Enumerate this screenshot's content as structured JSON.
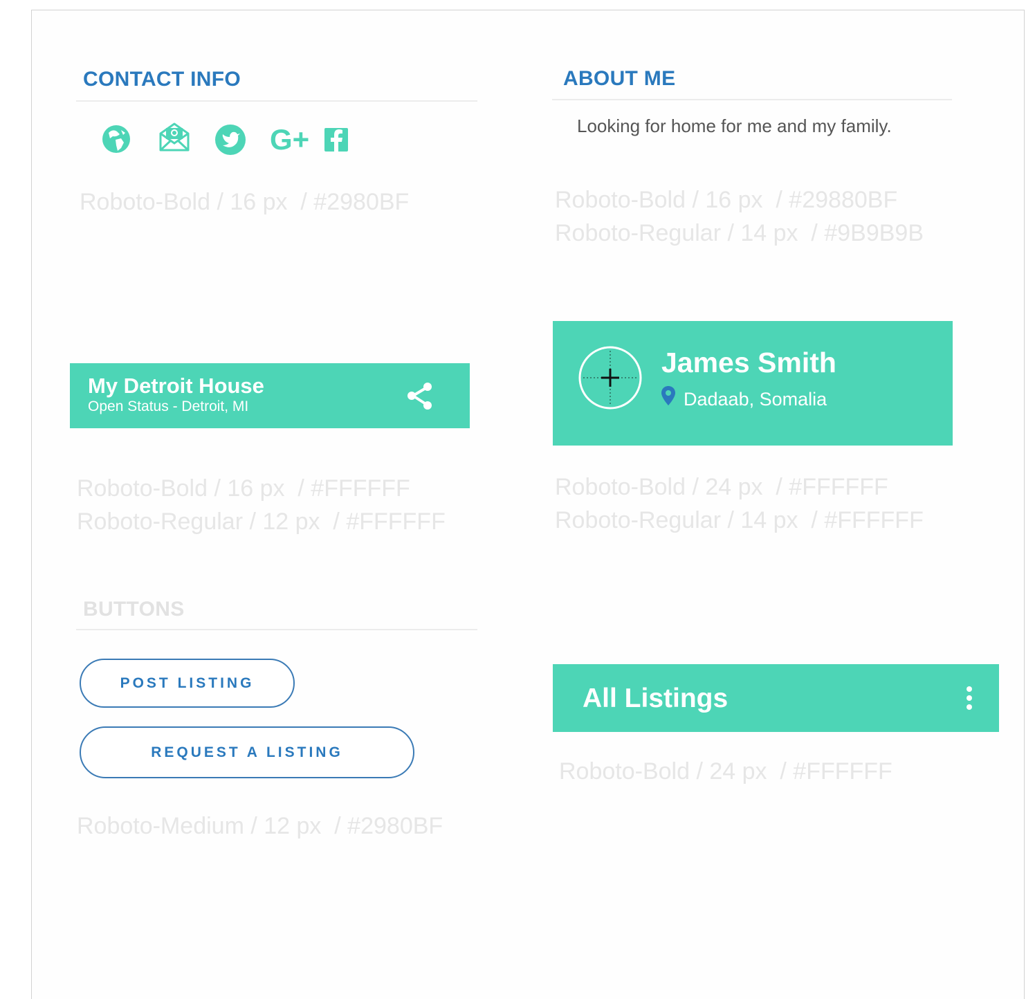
{
  "contact": {
    "heading": "CONTACT INFO",
    "icons": [
      "globe-icon",
      "email-icon",
      "twitter-icon",
      "google-plus-icon",
      "facebook-icon"
    ],
    "google_plus_text": "G+",
    "spec": "Roboto-Bold / 16 px  / #2980BF"
  },
  "about": {
    "heading": "ABOUT ME",
    "text": "Looking for home for me and my family.",
    "spec1": "Roboto-Bold / 16 px  / #29880BF",
    "spec2": "Roboto-Regular / 14 px  / #9B9B9B"
  },
  "listing_bar": {
    "title": "My Detroit House",
    "subtitle": "Open Status - Detroit, MI",
    "spec1": "Roboto-Bold / 16 px  / #FFFFFF",
    "spec2": "Roboto-Regular / 12 px  / #FFFFFF"
  },
  "profile": {
    "name": "James Smith",
    "location": "Dadaab, Somalia",
    "spec1": "Roboto-Bold / 24 px  / #FFFFFF",
    "spec2": "Roboto-Regular / 14 px  / #FFFFFF"
  },
  "buttons": {
    "heading": "BUTTONS",
    "post_label": "POST LISTING",
    "request_label": "REQUEST A LISTING",
    "spec": "Roboto-Medium / 12 px  / #2980BF"
  },
  "all_listings": {
    "title": "All Listings",
    "spec": "Roboto-Bold / 24 px  / #FFFFFF"
  },
  "colors": {
    "teal": "#4dd5b6",
    "blue": "#2a79bd",
    "white": "#ffffff",
    "spec_text": "#e6e6e6",
    "gray_text": "#555555"
  }
}
